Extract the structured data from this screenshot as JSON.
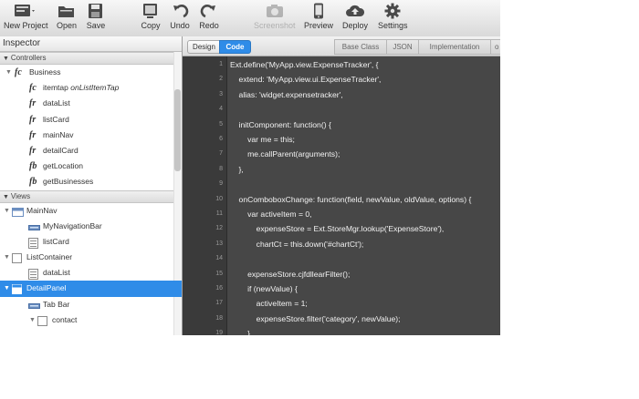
{
  "colors": {
    "accent": "#2f8ce8",
    "editor_bg": "#474747",
    "gutter_bg": "#3a3a3a"
  },
  "toolbar": {
    "buttons": [
      {
        "label": "New Project",
        "icon": "new-project-icon"
      },
      {
        "label": "Open",
        "icon": "open-folder-icon"
      },
      {
        "label": "Save",
        "icon": "save-disk-icon"
      },
      {
        "label": "Copy",
        "icon": "copy-icon"
      },
      {
        "label": "Undo",
        "icon": "undo-icon"
      },
      {
        "label": "Redo",
        "icon": "redo-icon"
      },
      {
        "label": "Screenshot",
        "icon": "camera-icon",
        "disabled": true
      },
      {
        "label": "Preview",
        "icon": "phone-icon"
      },
      {
        "label": "Deploy",
        "icon": "cloud-upload-icon"
      },
      {
        "label": "Settings",
        "icon": "gear-icon"
      }
    ]
  },
  "inspector": {
    "title": "Inspector",
    "controllers_header": "Controllers",
    "business_label": "Business",
    "business_icon": "fc",
    "business_items": [
      {
        "icon": "fc",
        "label": "itemtap",
        "target": "onListItemTap"
      },
      {
        "icon": "fr",
        "label": "dataList"
      },
      {
        "icon": "fr",
        "label": "listCard"
      },
      {
        "icon": "fr",
        "label": "mainNav"
      },
      {
        "icon": "fr",
        "label": "detailCard"
      },
      {
        "icon": "fb",
        "label": "getLocation"
      },
      {
        "icon": "fb",
        "label": "getBusinesses"
      }
    ],
    "views_header": "Views",
    "views": [
      {
        "label": "MainNav",
        "icon": "navigation-view-icon",
        "indent": 1,
        "toggle": "▼"
      },
      {
        "label": "MyNavigationBar",
        "icon": "toolbar-icon",
        "indent": 2
      },
      {
        "label": "listCard",
        "icon": "list-icon",
        "indent": 2
      },
      {
        "label": "ListContainer",
        "icon": "container-icon",
        "indent": 1,
        "toggle": "▼"
      },
      {
        "label": "dataList",
        "icon": "list-icon",
        "indent": 2
      },
      {
        "label": "DetailPanel",
        "icon": "panel-icon",
        "indent": 1,
        "toggle": "▼",
        "selected": true
      },
      {
        "label": "Tab Bar",
        "icon": "toolbar-icon",
        "indent": 2
      },
      {
        "label": "contact",
        "icon": "container-icon",
        "indent": 3,
        "toggle": "▼"
      }
    ]
  },
  "editor": {
    "tab_design": "Design",
    "tab_code": "Code",
    "right_tabs": [
      "Base Class",
      "JSON",
      "Implementation",
      "o"
    ],
    "lines": [
      {
        "n": "1",
        "text": "Ext.define('MyApp.view.ExpenseTracker', {"
      },
      {
        "n": "2",
        "text": "    extend: 'MyApp.view.ui.ExpenseTracker',"
      },
      {
        "n": "3",
        "text": "    alias: 'widget.expensetracker',"
      },
      {
        "n": "4",
        "text": ""
      },
      {
        "n": "5",
        "text": "    initComponent: function() {"
      },
      {
        "n": "6",
        "text": "        var me = this;"
      },
      {
        "n": "7",
        "text": "        me.callParent(arguments);"
      },
      {
        "n": "8",
        "text": "    },"
      },
      {
        "n": "9",
        "text": ""
      },
      {
        "n": "10",
        "text": "    onComboboxChange: function(field, newValue, oldValue, options) {"
      },
      {
        "n": "11",
        "text": "        var activeItem = 0,"
      },
      {
        "n": "12",
        "text": "            expenseStore = Ext.StoreMgr.lookup('ExpenseStore'),"
      },
      {
        "n": "13",
        "text": "            chartCt = this.down('#chartCt');"
      },
      {
        "n": "14",
        "text": ""
      },
      {
        "n": "15",
        "text": "        expenseStore.cjfdllearFilter();"
      },
      {
        "n": "16",
        "text": "        if (newValue) {"
      },
      {
        "n": "17",
        "text": "            activeItem = 1;"
      },
      {
        "n": "18",
        "text": "            expenseStore.filter('category', newValue);"
      },
      {
        "n": "19",
        "text": "        }"
      }
    ]
  }
}
